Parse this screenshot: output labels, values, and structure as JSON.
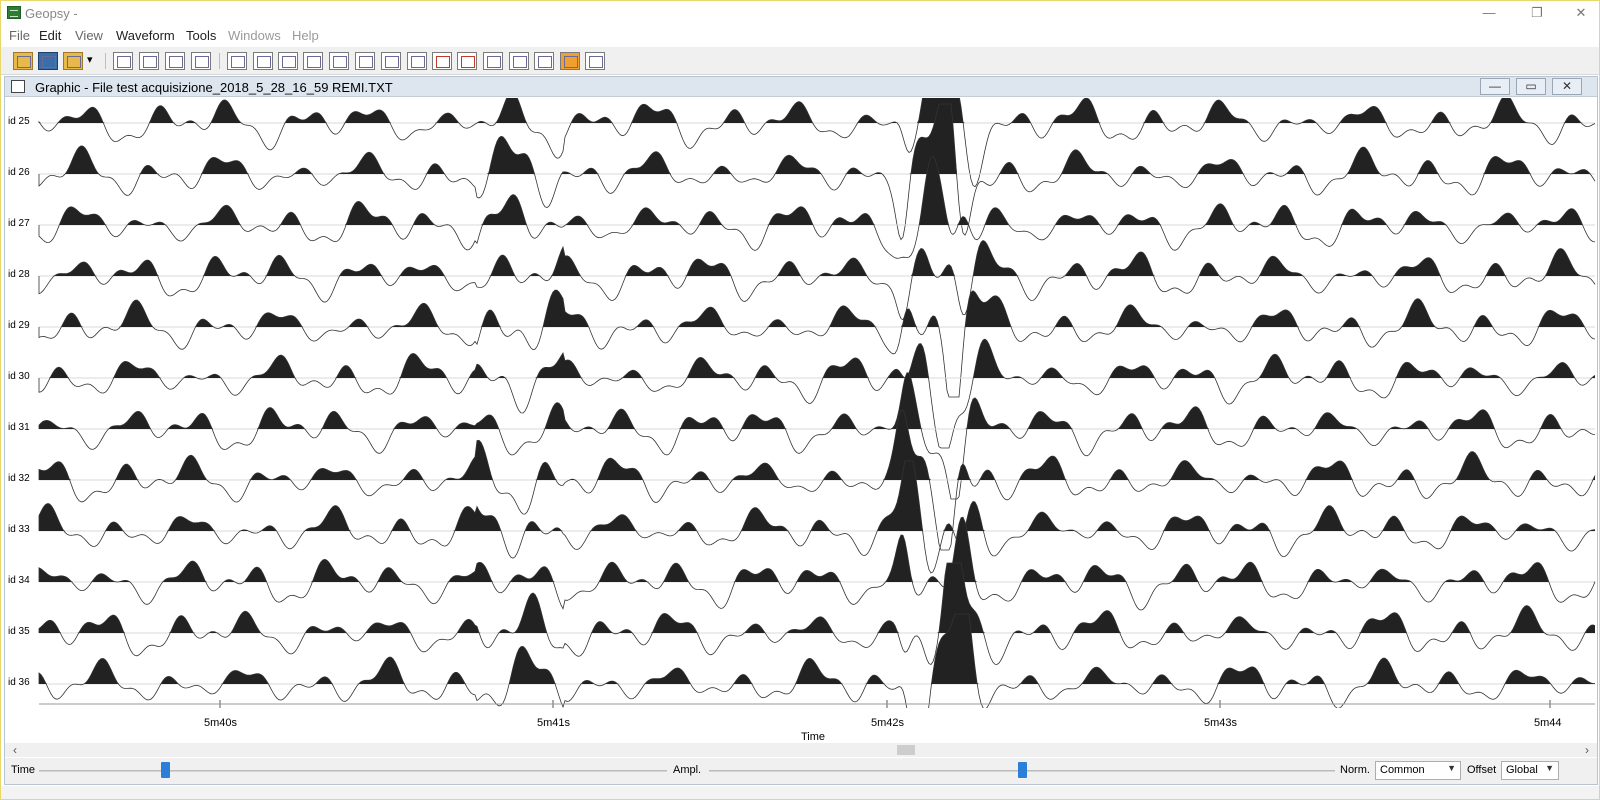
{
  "window": {
    "title": "Geopsy -",
    "controls": [
      "—",
      "❐",
      "✕"
    ]
  },
  "menu": [
    {
      "label": "File",
      "state": "enabled"
    },
    {
      "label": "Edit",
      "state": "strong"
    },
    {
      "label": "View",
      "state": "enabled"
    },
    {
      "label": "Waveform",
      "state": "strong"
    },
    {
      "label": "Tools",
      "state": "strong"
    },
    {
      "label": "Windows",
      "state": "disabled"
    },
    {
      "label": "Help",
      "state": "disabled"
    }
  ],
  "toolbar": {
    "buttons": [
      "open-icon",
      "save-icon",
      "load-menu-icon",
      "table-icon",
      "graphic-icon",
      "map-icon",
      "chart-icon",
      "pick-icon",
      "zoom-icon",
      "select-icon",
      "tool-a-icon",
      "tool-b-icon",
      "spectrum-icon",
      "wave-icon",
      "filter-icon",
      "red-tool-a-icon",
      "red-tool-b-icon",
      "grid-icon",
      "settings-icon",
      "list-icon",
      "orange-tool-icon",
      "export-icon"
    ]
  },
  "subwindow": {
    "title": "Graphic - File test acquisizione_2018_5_28_16_59 REMI.TXT",
    "controls": [
      "—",
      "▭",
      "✕"
    ]
  },
  "plot": {
    "traces": [
      "id 25",
      "id 26",
      "id 27",
      "id 28",
      "id 29",
      "id 30",
      "id 31",
      "id 32",
      "id 33",
      "id 34",
      "id 35",
      "id 36"
    ],
    "x_ticks": [
      "5m40s",
      "5m41s",
      "5m42s",
      "5m43s",
      "5m44"
    ],
    "x_label": "Time"
  },
  "scrollbar": {
    "left_arrow": "‹",
    "right_arrow": "›"
  },
  "status": {
    "time_label": "Time",
    "time_slider_value": 0.2,
    "ampl_label": "Ampl.",
    "ampl_slider_value": 0.5,
    "norm_label": "Norm.",
    "norm_value": "Common",
    "offset_label": "Offset",
    "offset_value": "Global"
  }
}
